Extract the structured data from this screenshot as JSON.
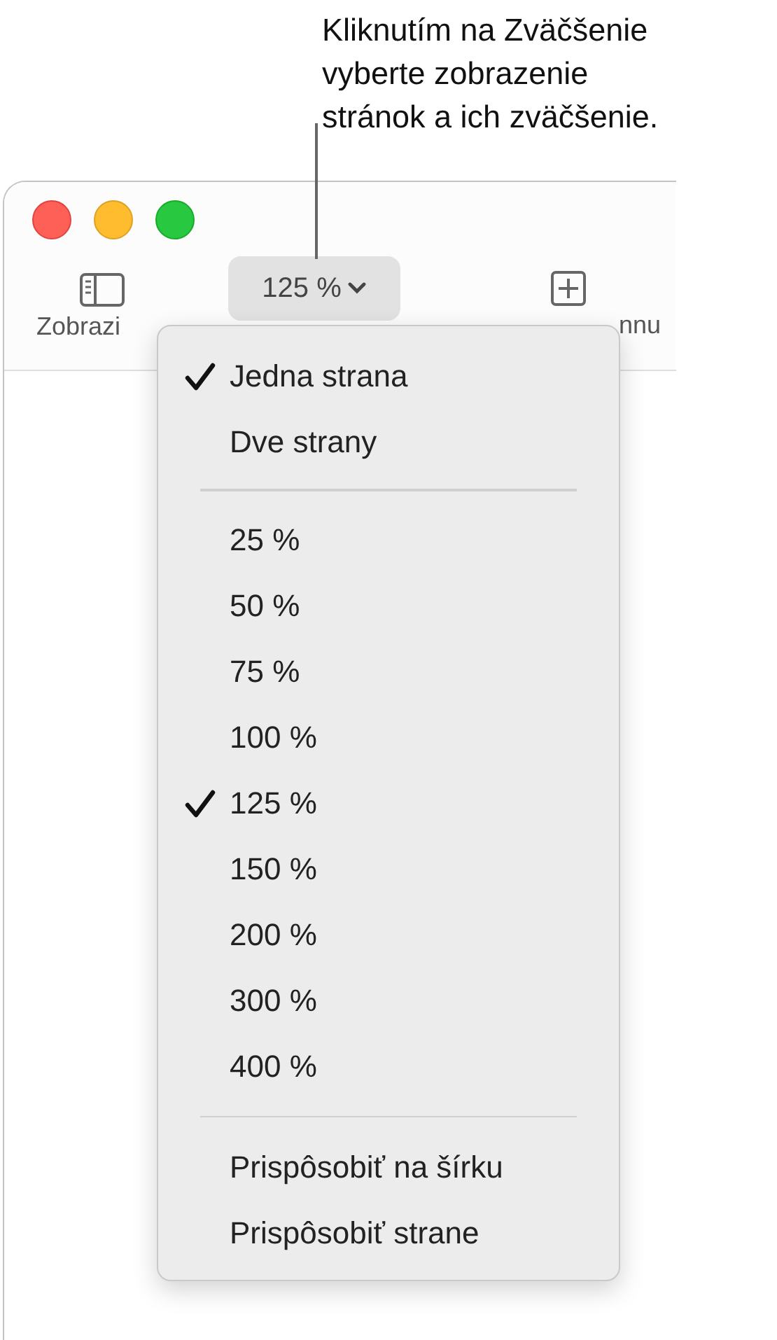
{
  "callout": {
    "text": "Kliknutím na Zväčšenie vyberte zobrazenie stránok a ich zväčšenie."
  },
  "toolbar": {
    "items": [
      {
        "kind": "sidebar",
        "label": "Zobrazi"
      },
      {
        "kind": "zoom",
        "label": "125 %"
      },
      {
        "kind": "add",
        "label": "nnu"
      }
    ]
  },
  "menu": {
    "groups": [
      {
        "items": [
          {
            "label": "Jedna strana",
            "checked": true
          },
          {
            "label": "Dve strany",
            "checked": false
          }
        ]
      },
      {
        "items": [
          {
            "label": "25 %",
            "checked": false
          },
          {
            "label": "50 %",
            "checked": false
          },
          {
            "label": "75 %",
            "checked": false
          },
          {
            "label": "100 %",
            "checked": false
          },
          {
            "label": "125 %",
            "checked": true
          },
          {
            "label": "150 %",
            "checked": false
          },
          {
            "label": "200 %",
            "checked": false
          },
          {
            "label": "300 %",
            "checked": false
          },
          {
            "label": "400 %",
            "checked": false
          }
        ]
      },
      {
        "items": [
          {
            "label": "Prispôsobiť na šírku",
            "checked": false
          },
          {
            "label": "Prispôsobiť strane",
            "checked": false
          }
        ]
      }
    ]
  }
}
